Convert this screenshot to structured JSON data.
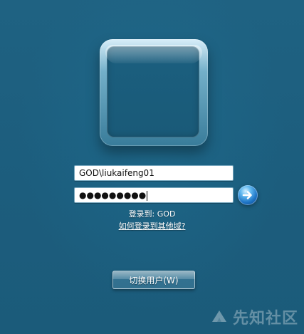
{
  "login": {
    "username_value": "GOD\\liukaifeng01",
    "password_mask": "●●●●●●●●●",
    "login_to_text": "登录到: GOD",
    "other_domain_link": "如何登录到其他域?",
    "switch_user_label": "切换用户(W)"
  },
  "watermark": {
    "text": "先知社区"
  },
  "colors": {
    "background": "#1e5f7f",
    "field_border": "#7aa9bf",
    "button_text": "#ffffff",
    "submit_blue": "#1d73c4"
  },
  "icons": {
    "submit": "arrow-right-circle-icon",
    "watermark": "logo-icon"
  }
}
